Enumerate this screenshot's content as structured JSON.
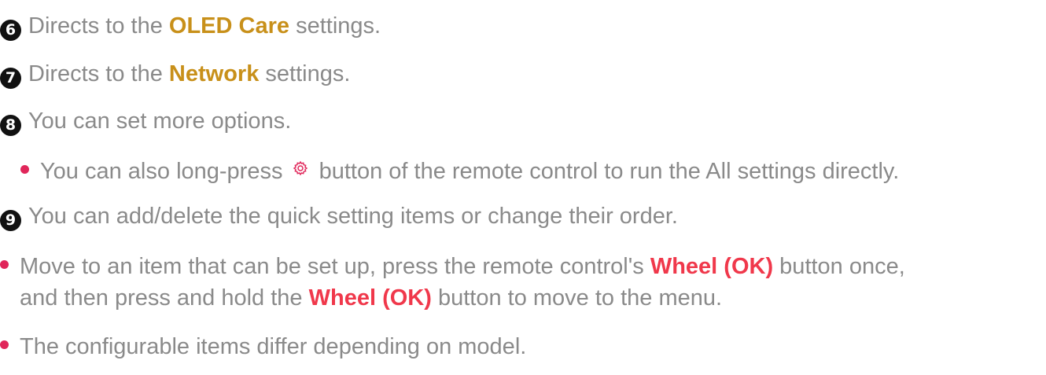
{
  "items": [
    {
      "number": "6",
      "before": "Directs to the ",
      "highlight": "OLED Care",
      "after": " settings."
    },
    {
      "number": "7",
      "before": "Directs to the ",
      "highlight": "Network",
      "after": " settings."
    },
    {
      "number": "8",
      "text": "You can set more options."
    },
    {
      "number": "9",
      "text": "You can add/delete the quick setting items or change their order."
    }
  ],
  "sub_bullet": {
    "before": "You can also long-press ",
    "icon": "gear-icon",
    "after": " button of the remote control to run the All settings directly."
  },
  "notes": [
    {
      "line1_before": "Move to an item that can be set up, press the remote control's ",
      "line1_highlight": "Wheel (OK)",
      "line1_after": " button once,",
      "line2_before": "and then press and hold the ",
      "line2_highlight": "Wheel (OK)",
      "line2_after": " button to move to the menu."
    },
    {
      "text": "The configurable items differ depending on model."
    }
  ],
  "colors": {
    "text": "#8a8a8a",
    "highlight_gold": "#c8901a",
    "highlight_red": "#f0384b",
    "bullet": "#e0265a",
    "number_badge": "#111111"
  }
}
